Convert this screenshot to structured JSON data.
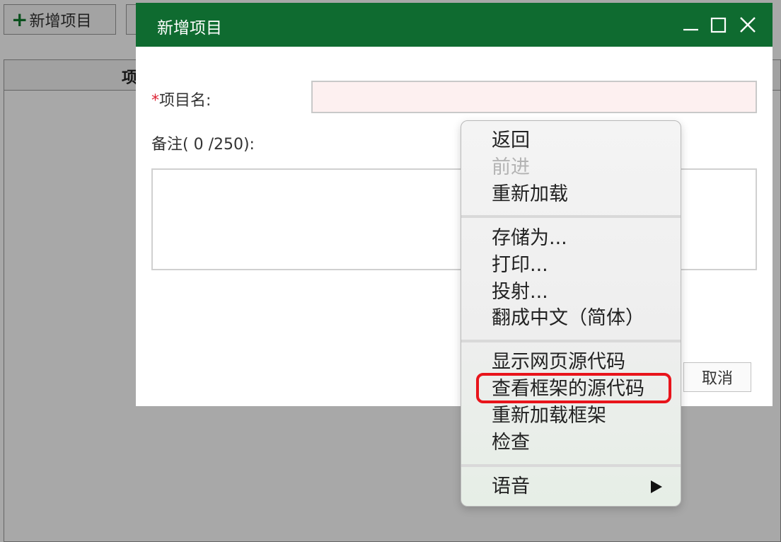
{
  "toolbar": {
    "add_project_plus": "+",
    "add_project_label": "新增项目"
  },
  "table": {
    "header_label": "项"
  },
  "dialog": {
    "title": "新增项目",
    "project_name_required_mark": "*",
    "project_name_label": "项目名:",
    "project_name_value": "",
    "remark_label": "备注( 0 /250):",
    "remark_value": "",
    "cancel_label": "取消"
  },
  "context_menu": {
    "items": [
      {
        "label": "返回",
        "enabled": true
      },
      {
        "label": "前进",
        "enabled": false
      },
      {
        "label": "重新加载",
        "enabled": true
      },
      {
        "label": "存储为...",
        "enabled": true
      },
      {
        "label": "打印...",
        "enabled": true
      },
      {
        "label": "投射...",
        "enabled": true
      },
      {
        "label": "翻成中文（简体）",
        "enabled": true
      },
      {
        "label": "显示网页源代码",
        "enabled": true
      },
      {
        "label": "查看框架的源代码",
        "enabled": true,
        "highlighted": true
      },
      {
        "label": "重新加载框架",
        "enabled": true
      },
      {
        "label": "检查",
        "enabled": true
      },
      {
        "label": "语音",
        "enabled": true,
        "has_submenu": true
      }
    ]
  },
  "colors": {
    "titlebar": "#0f6b30",
    "highlight": "#e8141b",
    "required": "#dd2233",
    "plus": "#117a2e"
  },
  "icons": [
    "plus-icon",
    "minimize-icon",
    "maximize-icon",
    "close-icon",
    "submenu-arrow-icon"
  ]
}
